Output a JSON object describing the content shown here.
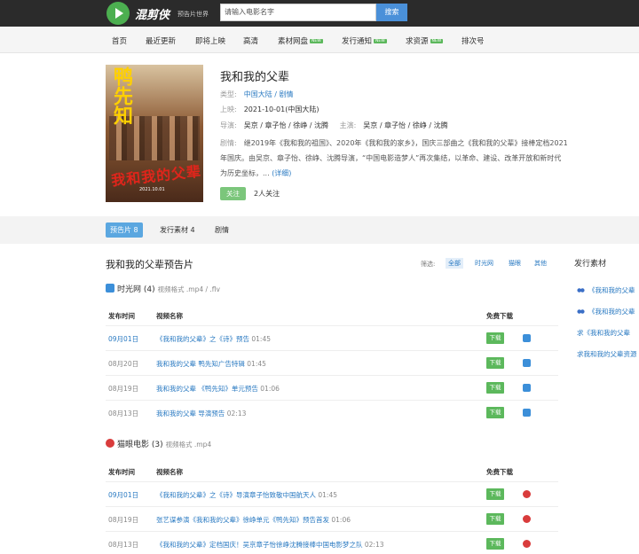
{
  "header": {
    "logo_text": "混剪侠",
    "logo_sub": "预告片世界",
    "search_placeholder": "请输入电影名字",
    "search_button": "搜索"
  },
  "nav": {
    "items": [
      {
        "label": "首页",
        "new": false
      },
      {
        "label": "最近更新",
        "new": false
      },
      {
        "label": "即将上映",
        "new": false
      },
      {
        "label": "高清",
        "new": false
      },
      {
        "label": "素材网盘",
        "new": true
      },
      {
        "label": "发行通知",
        "new": true
      },
      {
        "label": "求资源",
        "new": true
      },
      {
        "label": "排次号",
        "new": false
      }
    ],
    "new_badge": "NEW"
  },
  "movie": {
    "title": "我和我的父辈",
    "poster_title": "鸭先知",
    "poster_red": "我和我的父辈",
    "poster_date": "2021.10.01",
    "type_label": "类型:",
    "type_value": "中国大陆 / 剧情",
    "release_label": "上映:",
    "release_value": "2021-10-01(中国大陆)",
    "director_label": "导演:",
    "director_value": "吴京 / 章子怡 / 徐峥 / 沈腾",
    "cast_label": "主演:",
    "cast_value": "吴京 / 章子怡 / 徐峥 / 沈腾",
    "plot_label": "剧情:",
    "plot_text": "继2019年《我和我的祖国》、2020年《我和我的家乡》，国庆三部曲之《我和我的父辈》接棒定档2021年国庆。由吴京、章子怡、徐峥、沈腾导演，“中国电影造梦人”再次集结，以革命、建设、改革开放和新时代为历史坐标，...",
    "plot_more": "(详细)",
    "follow_button": "关注",
    "follow_count": "2人关注"
  },
  "tabs": [
    {
      "label": "预告片 8",
      "active": true
    },
    {
      "label": "发行素材 4",
      "active": false
    },
    {
      "label": "剧情",
      "active": false
    }
  ],
  "section": {
    "title": "我和我的父辈预告片",
    "filter_label": "筛选:",
    "filters": [
      {
        "label": "全部",
        "active": true
      },
      {
        "label": "时光网",
        "active": false
      },
      {
        "label": "猫眼",
        "active": false
      },
      {
        "label": "其他",
        "active": false
      }
    ]
  },
  "sidebar": {
    "title": "发行素材",
    "links": [
      {
        "label": "《我和我的父辈",
        "logo": true
      },
      {
        "label": "《我和我的父辈",
        "logo": true
      },
      {
        "label": "求《我和我的父辈",
        "logo": false
      },
      {
        "label": "求我和我的父辈资源",
        "logo": false
      }
    ]
  },
  "sources": [
    {
      "name": "时光网",
      "count": "(4)",
      "format": "视频格式 .mp4 / .flv",
      "icon": "mtime-icon",
      "col_date": "发布时间",
      "col_name": "视频名称",
      "col_dl": "免费下载",
      "rows": [
        {
          "date": "09月01日",
          "hl": true,
          "name": "《我和我的父辈》之《诗》预告",
          "dur": "01:45",
          "dl": "下载"
        },
        {
          "date": "08月20日",
          "hl": false,
          "name": "我和我的父辈 鸭先知广告特辑",
          "dur": "01:45",
          "dl": "下载"
        },
        {
          "date": "08月19日",
          "hl": false,
          "name": "我和我的父辈 《鸭先知》单元预告",
          "dur": "01:06",
          "dl": "下载"
        },
        {
          "date": "08月13日",
          "hl": false,
          "name": "我和我的父辈 导演预告",
          "dur": "02:13",
          "dl": "下载"
        }
      ]
    },
    {
      "name": "猫眼电影",
      "count": "(3)",
      "format": "视频格式 .mp4",
      "icon": "maoyan-icon",
      "col_date": "发布时间",
      "col_name": "视频名称",
      "col_dl": "免费下载",
      "rows": [
        {
          "date": "09月01日",
          "hl": true,
          "name": "《我和我的父辈》之《诗》导演章子怡致敬中国航天人",
          "dur": "01:45",
          "dl": "下载"
        },
        {
          "date": "08月19日",
          "hl": false,
          "name": "张艺谋参演《我和我的父辈》徐峥单元《鸭先知》预告首发",
          "dur": "01:06",
          "dl": "下载"
        },
        {
          "date": "08月13日",
          "hl": false,
          "name": "《我和我的父辈》定档国庆！吴京章子怡徐峥沈腾接棒中国电影梦之队",
          "dur": "02:13",
          "dl": "下载"
        }
      ]
    }
  ]
}
